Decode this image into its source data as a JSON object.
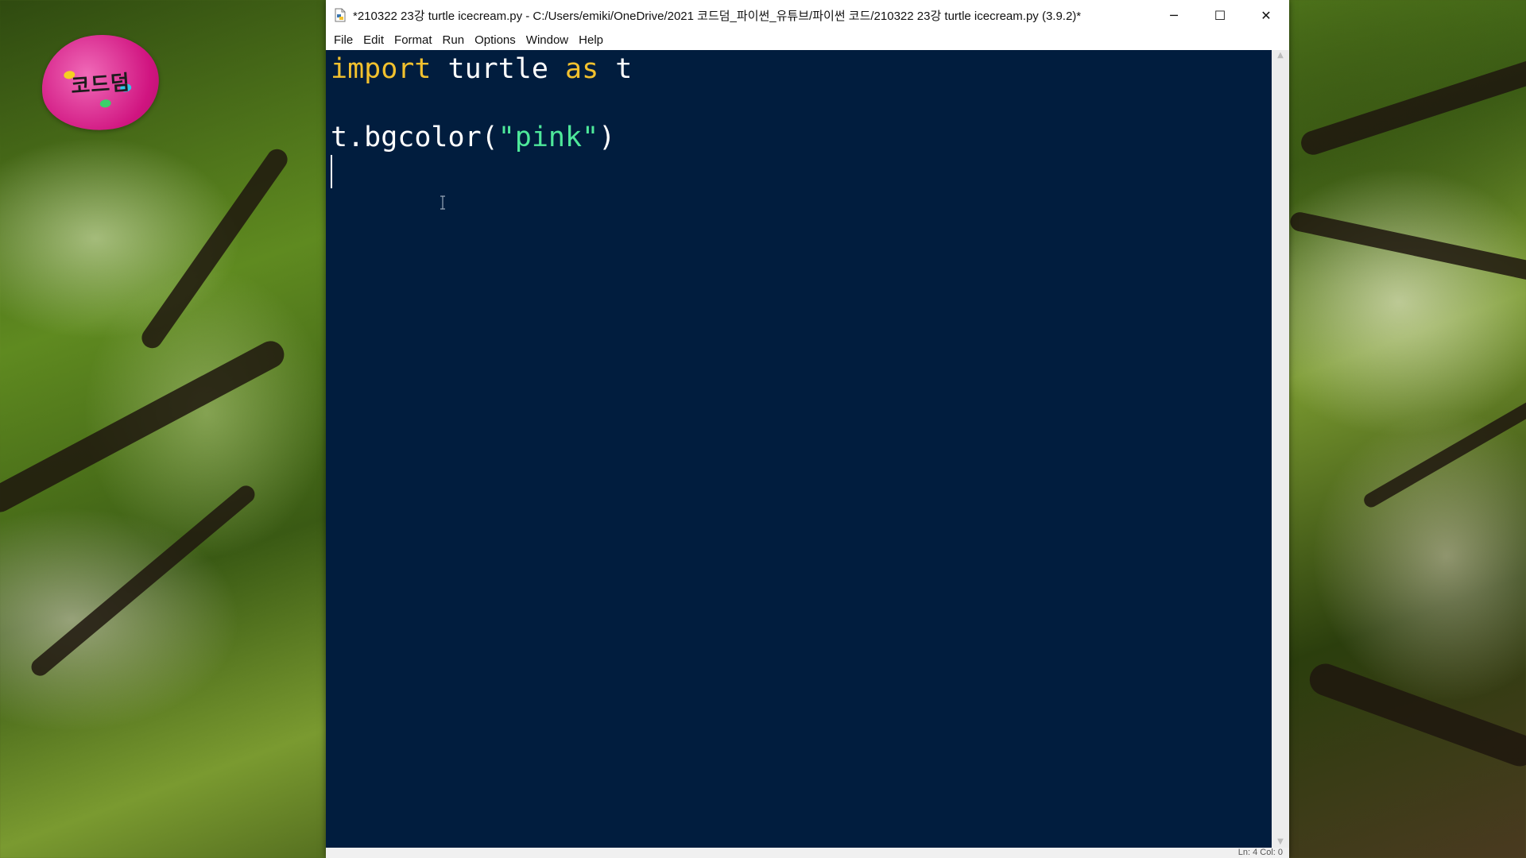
{
  "window": {
    "title": "*210322 23강 turtle icecream.py - C:/Users/emiki/OneDrive/2021 코드덤_파이썬_유튜브/파이썬 코드/210322 23강 turtle icecream.py (3.9.2)*",
    "controls": {
      "minimize": "─",
      "maximize": "☐",
      "close": "✕"
    }
  },
  "menu": {
    "items": [
      "File",
      "Edit",
      "Format",
      "Run",
      "Options",
      "Window",
      "Help"
    ]
  },
  "editor": {
    "line1": {
      "kw1": "import",
      "sp1": " turtle ",
      "kw2": "as",
      "sp2": " t"
    },
    "line3": {
      "pre": "t.bgcolor(",
      "str": "\"pink\"",
      "post": ")"
    },
    "colors": {
      "background": "#011d3e",
      "keyword": "#f2c12e",
      "string": "#4ee89a",
      "text": "#ffffff"
    }
  },
  "status": {
    "text": "Ln: 4   Col: 0"
  },
  "logo": {
    "text": "코드덤",
    "color": "#d01480"
  }
}
